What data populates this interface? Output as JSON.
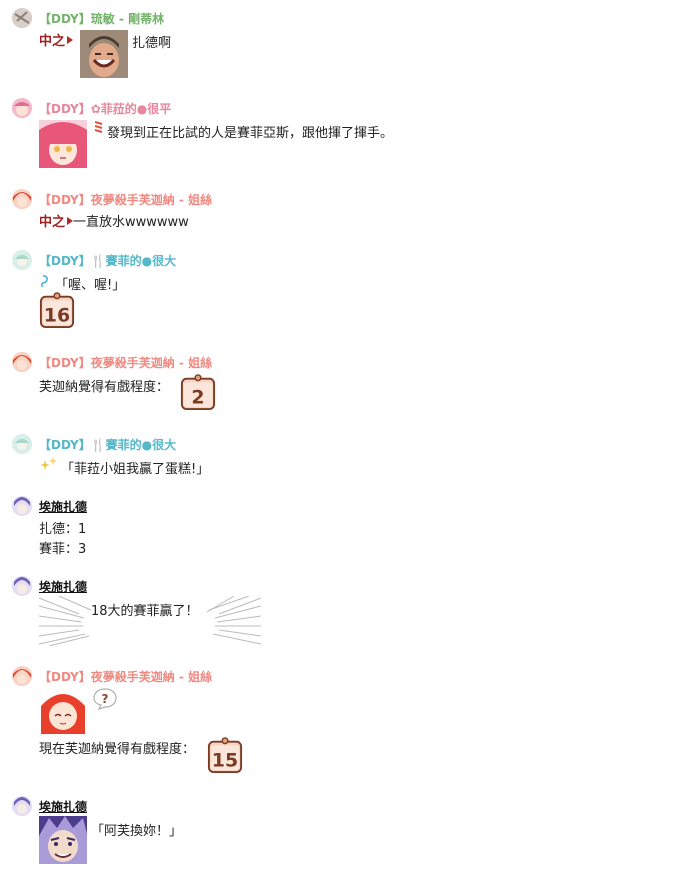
{
  "colors": {
    "green_name": "#74b36a",
    "pink_name": "#e7879b",
    "salmon_name": "#ee8a82",
    "teal_name": "#55b8c9",
    "dark_name": "#111111",
    "tag_red": "#a02020"
  },
  "messages": [
    {
      "id": "m1",
      "name": "【DDY】琉敏 - 剛蒂林",
      "name_color": "green",
      "lines": [
        {
          "tag": "中之",
          "text": "扎德啊"
        }
      ],
      "avatar_icon": "ryumin-avatar",
      "image_icon": "photo-man-laughing"
    },
    {
      "id": "m2",
      "name": "【DDY】✿菲菈的●很平",
      "name_color": "pink",
      "lines": [
        {
          "text": "發現到正在比試的人是賽菲亞斯，跟他揮了揮手。"
        }
      ],
      "avatar_icon": "pink-girl-avatar",
      "image_icon": "pink-girl-portrait"
    },
    {
      "id": "m3",
      "name": "【DDY】夜夢殺手芙迦納 - 姐絲",
      "name_color": "salmon",
      "lines": [
        {
          "tag": "中之",
          "text": "一直放水wwwwww"
        }
      ],
      "avatar_icon": "red-girl-avatar"
    },
    {
      "id": "m4",
      "name": "【DDY】🍴賽菲的●很大",
      "name_color": "teal",
      "lines": [
        {
          "text": "「喔、喔!」"
        }
      ],
      "avatar_icon": "teal-avatar",
      "counter": "16"
    },
    {
      "id": "m5",
      "name": "【DDY】夜夢殺手芙迦納 - 姐絲",
      "name_color": "salmon",
      "lines": [
        {
          "text": "芙迦納覺得有戲程度："
        }
      ],
      "avatar_icon": "red-girl-avatar",
      "counter": "2"
    },
    {
      "id": "m6",
      "name": "【DDY】🍴賽菲的●很大",
      "name_color": "teal",
      "lines": [
        {
          "text": "「菲菈小姐我贏了蛋糕!」"
        }
      ],
      "avatar_icon": "teal-avatar"
    },
    {
      "id": "m7",
      "name": "埃施扎德",
      "name_color": "dark",
      "lines": [
        {
          "text": "扎德：1"
        },
        {
          "text": "賽菲：3"
        }
      ],
      "avatar_icon": "purple-avatar"
    },
    {
      "id": "m8",
      "name": "埃施扎德",
      "name_color": "dark",
      "lines": [
        {
          "text": "18大的賽菲贏了！"
        }
      ],
      "avatar_icon": "purple-avatar"
    },
    {
      "id": "m9",
      "name": "【DDY】夜夢殺手芙迦納 - 姐絲",
      "name_color": "salmon",
      "lines": [
        {
          "text": "現在芙迦納覺得有戲程度："
        }
      ],
      "avatar_icon": "red-girl-avatar",
      "image_icon": "red-girl-smiling",
      "counter": "15"
    },
    {
      "id": "m10",
      "name": "埃施扎德",
      "name_color": "dark",
      "lines": [
        {
          "text": "「阿芙換妳！」"
        }
      ],
      "avatar_icon": "purple-avatar",
      "image_icon": "purple-man-portrait"
    }
  ]
}
